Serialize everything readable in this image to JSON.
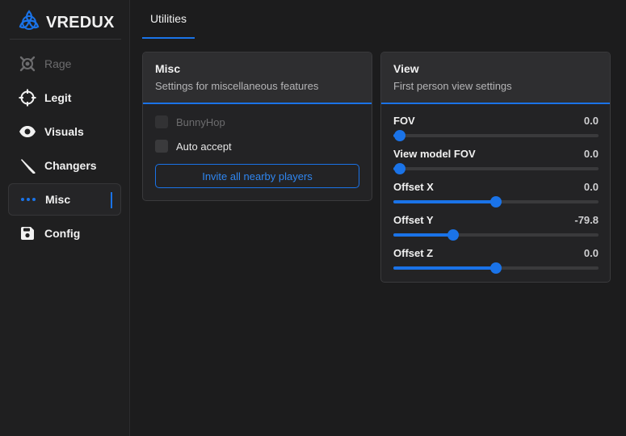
{
  "app": {
    "brand": "VREDUX",
    "accent": "#1a73e8"
  },
  "sidebar": {
    "items": [
      {
        "label": "Rage",
        "icon": "rage-icon",
        "state": "disabled"
      },
      {
        "label": "Legit",
        "icon": "crosshair-icon",
        "state": "normal"
      },
      {
        "label": "Visuals",
        "icon": "eye-icon",
        "state": "normal"
      },
      {
        "label": "Changers",
        "icon": "knife-icon",
        "state": "normal"
      },
      {
        "label": "Misc",
        "icon": "dots-icon",
        "state": "active"
      },
      {
        "label": "Config",
        "icon": "save-icon",
        "state": "normal"
      }
    ]
  },
  "tabs": [
    {
      "label": "Utilities",
      "active": true
    }
  ],
  "misc_card": {
    "title": "Misc",
    "subtitle": "Settings for miscellaneous features",
    "checkboxes": [
      {
        "label": "BunnyHop",
        "checked": false,
        "disabled": true
      },
      {
        "label": "Auto accept",
        "checked": false,
        "disabled": false
      }
    ],
    "button_label": "Invite all nearby players"
  },
  "view_card": {
    "title": "View",
    "subtitle": "First person view settings",
    "sliders": [
      {
        "label": "FOV",
        "value": "0.0",
        "fraction": 0.03
      },
      {
        "label": "View model FOV",
        "value": "0.0",
        "fraction": 0.03
      },
      {
        "label": "Offset X",
        "value": "0.0",
        "fraction": 0.5
      },
      {
        "label": "Offset Y",
        "value": "-79.8",
        "fraction": 0.29
      },
      {
        "label": "Offset Z",
        "value": "0.0",
        "fraction": 0.5
      }
    ]
  }
}
